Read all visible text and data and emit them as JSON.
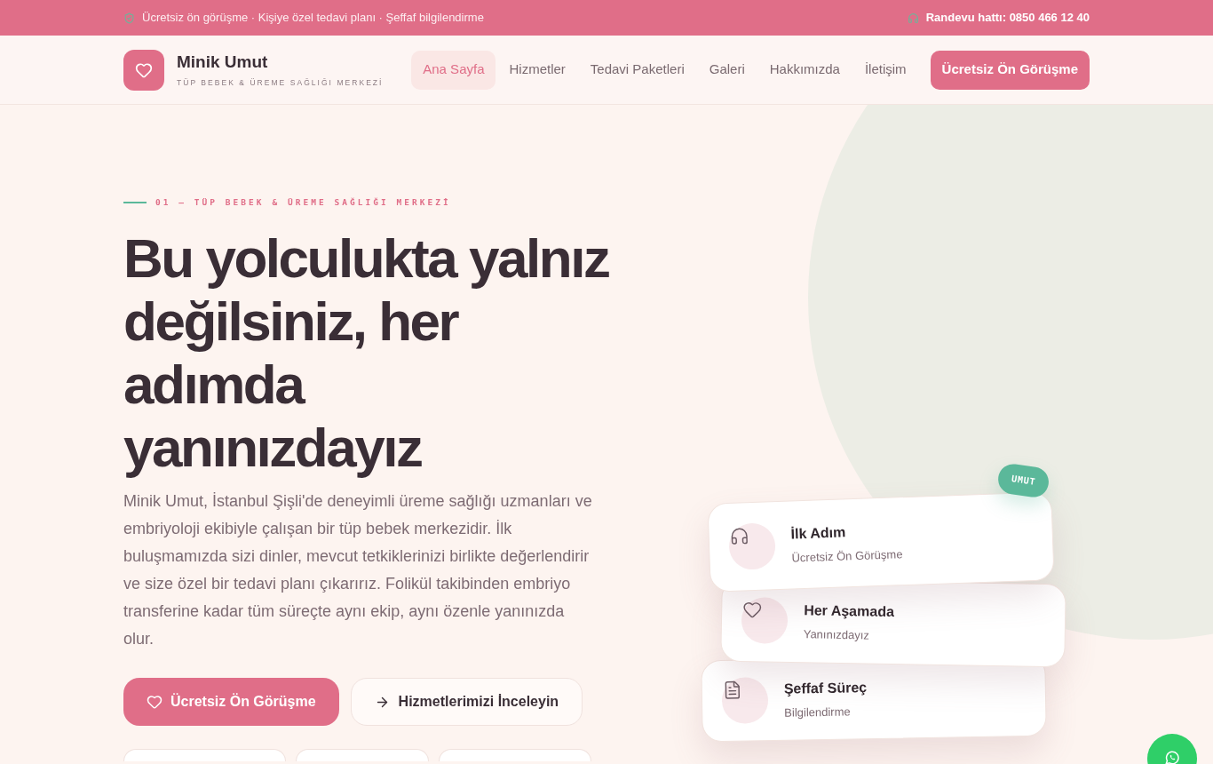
{
  "top_bar": {
    "tagline": "Ücretsiz ön görüşme · Kişiye özel tedavi planı · Şeffaf bilgilendirme",
    "hotline": "Randevu hattı: 0850 466 12 40"
  },
  "header": {
    "logo": {
      "name": "Minik Umut",
      "subtitle": "TÜP BEBEK & ÜREME SAĞLIĞI MERKEZİ"
    },
    "nav": [
      {
        "label": "Ana Sayfa",
        "selected": true
      },
      {
        "label": "Hizmetler",
        "selected": false
      },
      {
        "label": "Tedavi Paketleri",
        "selected": false
      },
      {
        "label": "Galeri",
        "selected": false
      },
      {
        "label": "Hakkımızda",
        "selected": false
      },
      {
        "label": "İletişim",
        "selected": false
      }
    ],
    "cta": "Ücretsiz Ön Görüşme"
  },
  "hero": {
    "eyebrow": "01 — TÜP BEBEK & ÜREME SAĞLIĞI MERKEZİ",
    "heading_lines": [
      "Bu yolculukta yalnız",
      "değilsiniz, her",
      "adımda",
      "yanınızdayız"
    ],
    "description": "Minik Umut, İstanbul Şişli'de deneyimli üreme sağlığı uzmanları ve embriyoloji ekibiyle çalışan bir tüp bebek merkezidir. İlk buluşmamızda sizi dinler, mevcut tetkiklerinizi birlikte değerlendirir ve size özel bir tedavi planı çıkarırız. Folikül takibinden embriyo transferine kadar tüm süreçte aynı ekip, aynı özenle yanınızda olur.",
    "buttons": [
      {
        "kind": "primary",
        "label": "Ücretsiz Ön Görüşme"
      },
      {
        "kind": "secondary",
        "label": "Hizmetlerimizi İnceleyin"
      }
    ],
    "badge": "UMUT",
    "cards": [
      {
        "kind": "headset",
        "title": "İlk Adım",
        "subtitle": "Ücretsiz Ön Görüşme"
      },
      {
        "kind": "heart",
        "title": "Her Aşamada",
        "subtitle": "Yanınızdayız"
      },
      {
        "kind": "document",
        "title": "Şeffaf Süreç",
        "subtitle": "Bilgilendirme"
      }
    ]
  }
}
